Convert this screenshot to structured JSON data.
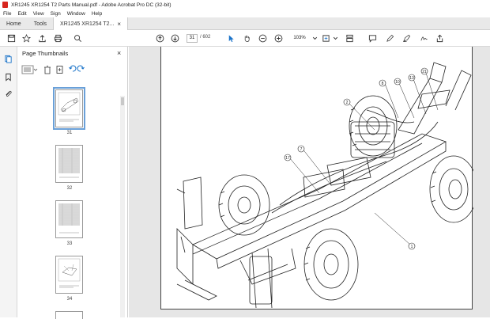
{
  "window": {
    "title": "XR1245 XR1254 T2 Parts Manual.pdf - Adobe Acrobat Pro DC (32-bit)"
  },
  "menu": [
    "File",
    "Edit",
    "View",
    "Sign",
    "Window",
    "Help"
  ],
  "tabs": {
    "home": "Home",
    "tools": "Tools",
    "document": "XR1245 XR1254 T2...",
    "close": "×"
  },
  "toolbar": {
    "page_current": "31",
    "page_total": "/ 602",
    "zoom": "103%"
  },
  "panel": {
    "title": "Page Thumbnails",
    "close": "×",
    "thumbnails": [
      {
        "label": "31",
        "selected": true
      },
      {
        "label": "32",
        "selected": false
      },
      {
        "label": "33",
        "selected": false
      },
      {
        "label": "34",
        "selected": false
      }
    ]
  },
  "drawing": {
    "callouts": [
      "1",
      "2",
      "7",
      "8",
      "10",
      "13",
      "17",
      "21"
    ]
  },
  "colors": {
    "accent": "#1a73c9",
    "selection": "#6aa0d8",
    "brand": "#d7261e"
  }
}
